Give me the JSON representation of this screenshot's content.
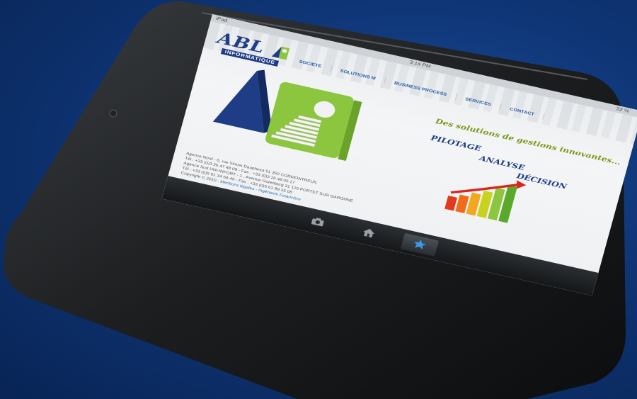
{
  "status_bar": {
    "device": "iPad",
    "time": "3:14 PM",
    "battery": "32 %"
  },
  "logo": {
    "name": "ABL",
    "subtitle": "INFORMATIQUE"
  },
  "nav": {
    "items": [
      {
        "label": "SOCIETE"
      },
      {
        "label": "SOLUTIONS M"
      },
      {
        "label": "BUSINESS PROCESS"
      },
      {
        "label": "SERVICES"
      },
      {
        "label": "CONTACT"
      }
    ]
  },
  "hero": {
    "tagline": "Des solutions de gestions innovantes...",
    "keywords": [
      "PILOTAGE",
      "ANALYSE",
      "DÉCISION"
    ]
  },
  "footer": {
    "line1": "Agence Nord - 6, rue Simon Dauphinot 51 350 CORMONTREUIL",
    "line2": "Tél : +33 (0)3 26 47 48 09 - Fax : +33 (0)3 26 48 05 17",
    "line3": "Agence Sud UNI-INFORT - 1 , Avenue Gutenberg 31 120 PORTET SUR GARONNE",
    "line4": "Tél : +33 (0)5 61 34 64 45 - Fax : +33 (0)5 61 99 35 08",
    "copyright": "Copyright © 2010 - ",
    "link_legal": "Mentions légales",
    "separator": " - ",
    "link_eng": "Ingénierie Financière"
  },
  "dock": {
    "tabs": [
      {
        "icon": "camera-icon"
      },
      {
        "icon": "home-icon"
      },
      {
        "icon": "star-icon"
      }
    ]
  },
  "colors": {
    "background": "#0f3677",
    "brand_blue": "#1f3d86",
    "brand_green": "#8cc63f",
    "nav_blue": "#2b5ea8"
  }
}
